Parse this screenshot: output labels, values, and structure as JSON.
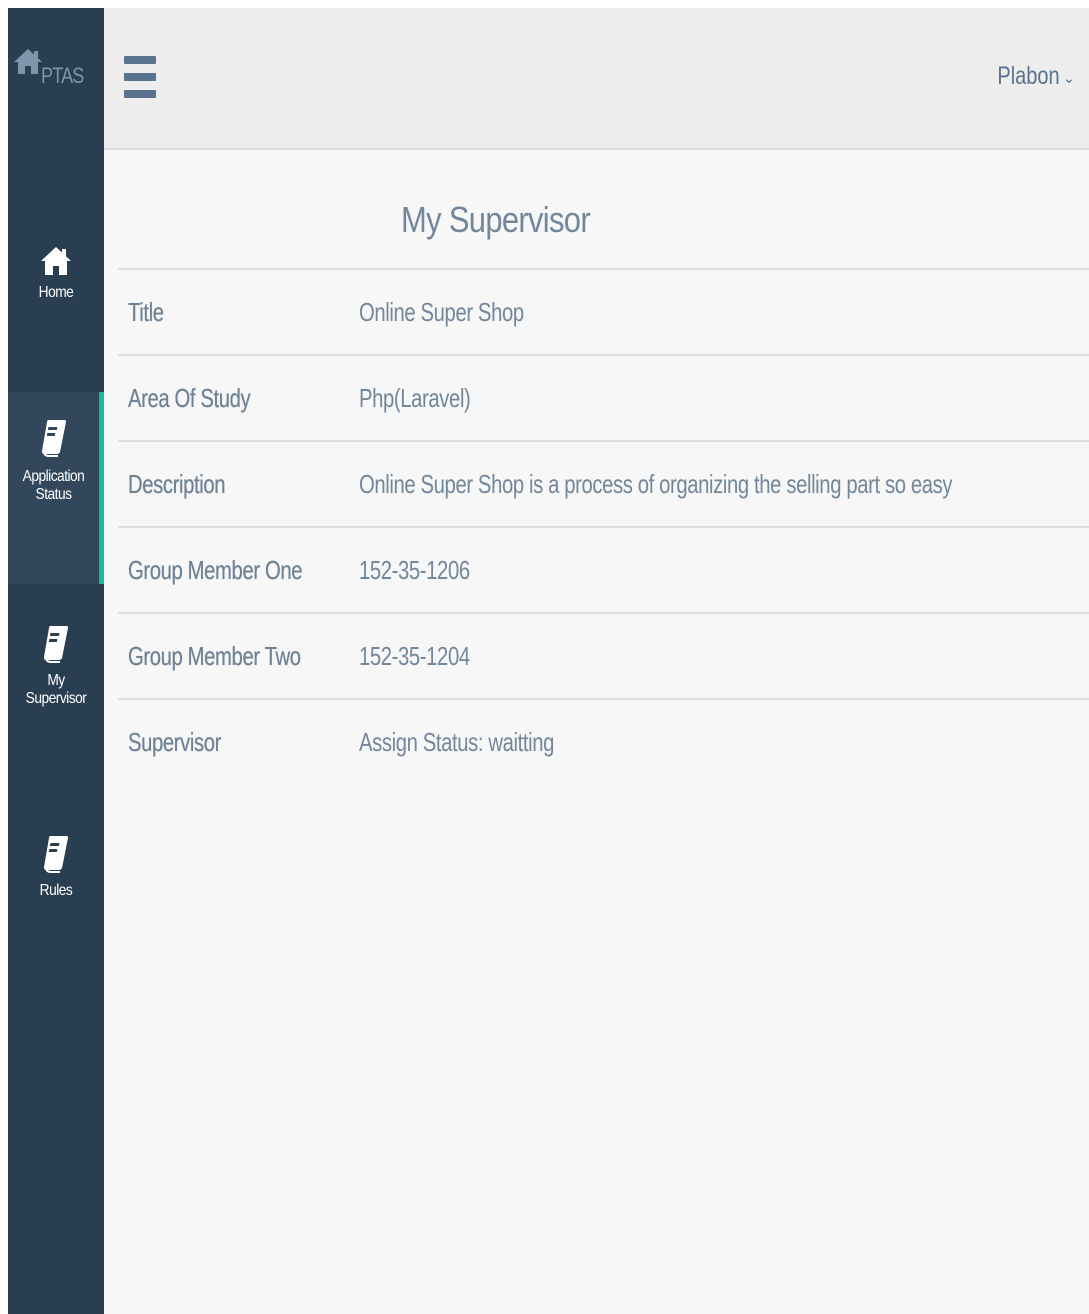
{
  "brand": {
    "icon": "home-icon",
    "name": "PTAS"
  },
  "topbar": {
    "menu_icon": "hamburger-icon",
    "user_name": "Plabon",
    "user_chevron": "⌄"
  },
  "sidebar": {
    "items": [
      {
        "label": "Home",
        "icon": "home-icon",
        "active": false
      },
      {
        "label_line1": "Application",
        "label_line2": "Status",
        "icon": "book-icon",
        "active": true
      },
      {
        "label_line1": "My",
        "label_line2": "Supervisor",
        "icon": "book-icon",
        "active": false
      },
      {
        "label": "Rules",
        "icon": "book-icon",
        "active": false
      }
    ]
  },
  "main": {
    "title": "My Supervisor",
    "rows": [
      {
        "label": "Title",
        "value": "Online Super Shop"
      },
      {
        "label": "Area Of Study",
        "value": "Php(Laravel)"
      },
      {
        "label": "Description",
        "value": "Online Super Shop is a process of organizing the selling part so easy"
      },
      {
        "label": "Group Member One",
        "value": "152-35-1206"
      },
      {
        "label": "Group Member Two",
        "value": "152-35-1204"
      },
      {
        "label": "Supervisor",
        "value": "Assign Status: waitting"
      }
    ]
  },
  "colors": {
    "sidebar_bg": "#2a3e52",
    "active_accent": "#1abb9c",
    "text_muted": "#73879c",
    "topbar_bg": "#ededed"
  }
}
